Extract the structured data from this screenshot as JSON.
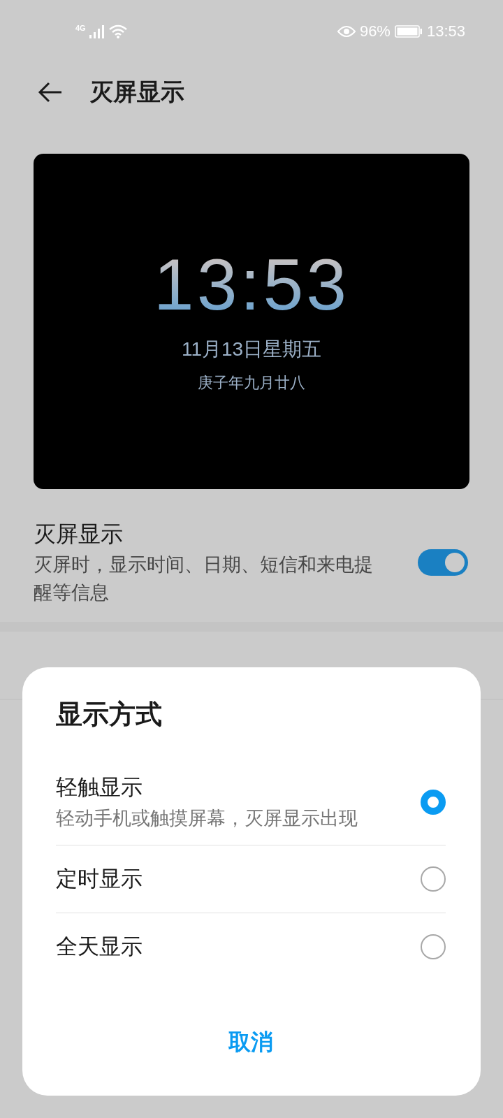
{
  "status_bar": {
    "network": "4G",
    "battery": "96%",
    "time": "13:53"
  },
  "header": {
    "title": "灭屏显示"
  },
  "preview": {
    "time": "13:53",
    "date": "11月13日星期五",
    "lunar": "庚子年九月廿八"
  },
  "setting": {
    "title": "灭屏显示",
    "description": "灭屏时，显示时间、日期、短信和来电提醒等信息",
    "on": true
  },
  "dialog": {
    "title": "显示方式",
    "options": [
      {
        "label": "轻触显示",
        "description": "轻动手机或触摸屏幕，灭屏显示出现",
        "selected": true
      },
      {
        "label": "定时显示",
        "selected": false
      },
      {
        "label": "全天显示",
        "selected": false
      }
    ],
    "cancel": "取消"
  }
}
